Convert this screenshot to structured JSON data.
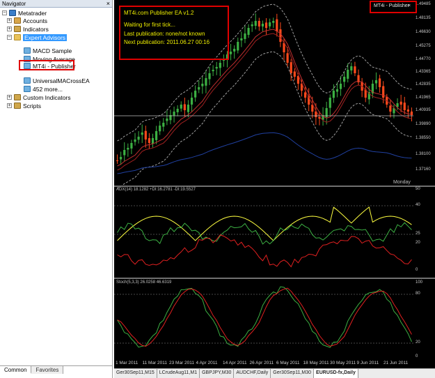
{
  "navigator": {
    "title": "Navigator",
    "close": "×",
    "root": "Metatrader",
    "items": {
      "accounts": "Accounts",
      "indicators": "Indicators",
      "expert_advisors": "Expert Advisors",
      "macd": "MACD Sample",
      "moving_average": "Moving Average",
      "mt4i": "MT4i - Publisher",
      "universal": "UniversalMACrossEA",
      "more": "452 more...",
      "custom_indicators": "Custom Indicators",
      "scripts": "Scripts"
    },
    "tabs": [
      "Common",
      "Favorites"
    ]
  },
  "chart": {
    "expert_label": "MT4i - Publisher",
    "ea_lines": [
      "MT4i.com Publisher EA v1.2",
      "Waiting for first tick...",
      "Last publication: none/not known",
      "Next publication: 2011.06.27 00:16"
    ],
    "price_ticks": [
      "1.49485",
      "1.48135",
      "1.46630",
      "1.45275",
      "1.44770",
      "1.43365",
      "1.42835",
      "1.41965",
      "1.40935",
      "1.39890",
      "1.38550",
      "1.38100",
      "1.37160"
    ],
    "adx_title": "ADX(14) 18.1282 +DI:16.2781 -DI:19.5527",
    "adx_ticks": [
      "50",
      "40",
      "25",
      "20",
      "0"
    ],
    "stoch_title": "Stoch(5,3,3) 26.0258 46.6319",
    "stoch_ticks": [
      "100",
      "80",
      "20",
      "0"
    ],
    "dates": [
      "1 Mar 2011",
      "11 Mar 2011",
      "23 Mar 2011",
      "4 Apr 2011",
      "14 Apr 2011",
      "26 Apr 2011",
      "6 May 2011",
      "18 May 2011",
      "30 May 2011",
      "9 Jun 2011",
      "21 Jun 2011"
    ],
    "monday_label": "Monday",
    "colors": {
      "bull": "#3cb043",
      "bear": "#ff4a1c",
      "adx": "#ffff40",
      "plus_di": "#3cb043",
      "minus_di": "#e02020",
      "stoch_main": "#3cb043",
      "stoch_signal": "#e02020"
    }
  },
  "chart_tabs": [
    "Ger30Sep11,M15",
    "LCrudeAug11,M1",
    "GBPJPY,M30",
    "AUDCHF,Daily",
    "Ger30Sep11,M30",
    "EURUSD-fx,Daily"
  ],
  "active_tab": "EURUSD-fx,Daily"
}
